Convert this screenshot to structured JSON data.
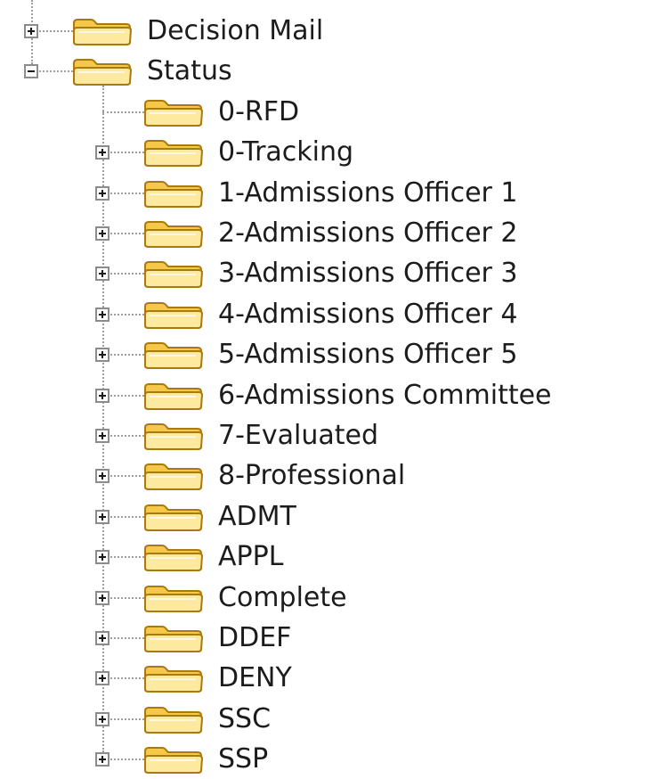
{
  "tree": {
    "top_nodes": [
      {
        "label": "Decision Mail",
        "expanded": false
      },
      {
        "label": "Status",
        "expanded": true
      }
    ],
    "status_children": [
      {
        "label": "0-RFD",
        "expandable": false
      },
      {
        "label": "0-Tracking",
        "expandable": true
      },
      {
        "label": "1-Admissions Officer 1",
        "expandable": true
      },
      {
        "label": "2-Admissions Officer 2",
        "expandable": true
      },
      {
        "label": "3-Admissions Officer 3",
        "expandable": true
      },
      {
        "label": "4-Admissions Officer 4",
        "expandable": true
      },
      {
        "label": "5-Admissions Officer 5",
        "expandable": true
      },
      {
        "label": "6-Admissions Committee",
        "expandable": true
      },
      {
        "label": "7-Evaluated",
        "expandable": true
      },
      {
        "label": "8-Professional",
        "expandable": true
      },
      {
        "label": "ADMT",
        "expandable": true
      },
      {
        "label": "APPL",
        "expandable": true
      },
      {
        "label": "Complete",
        "expandable": true
      },
      {
        "label": "DDEF",
        "expandable": true
      },
      {
        "label": "DENY",
        "expandable": true
      },
      {
        "label": "SSC",
        "expandable": true
      },
      {
        "label": "SSP",
        "expandable": true
      }
    ]
  },
  "icons": {
    "folder": "folder-icon",
    "expand": "plus-expander-icon",
    "collapse": "minus-expander-icon"
  },
  "colors": {
    "folder_body": "#f5c84a",
    "folder_light": "#fde9a0",
    "folder_outline": "#a87a10",
    "tree_line": "#a0a0a0",
    "text": "#1c1c1c"
  }
}
